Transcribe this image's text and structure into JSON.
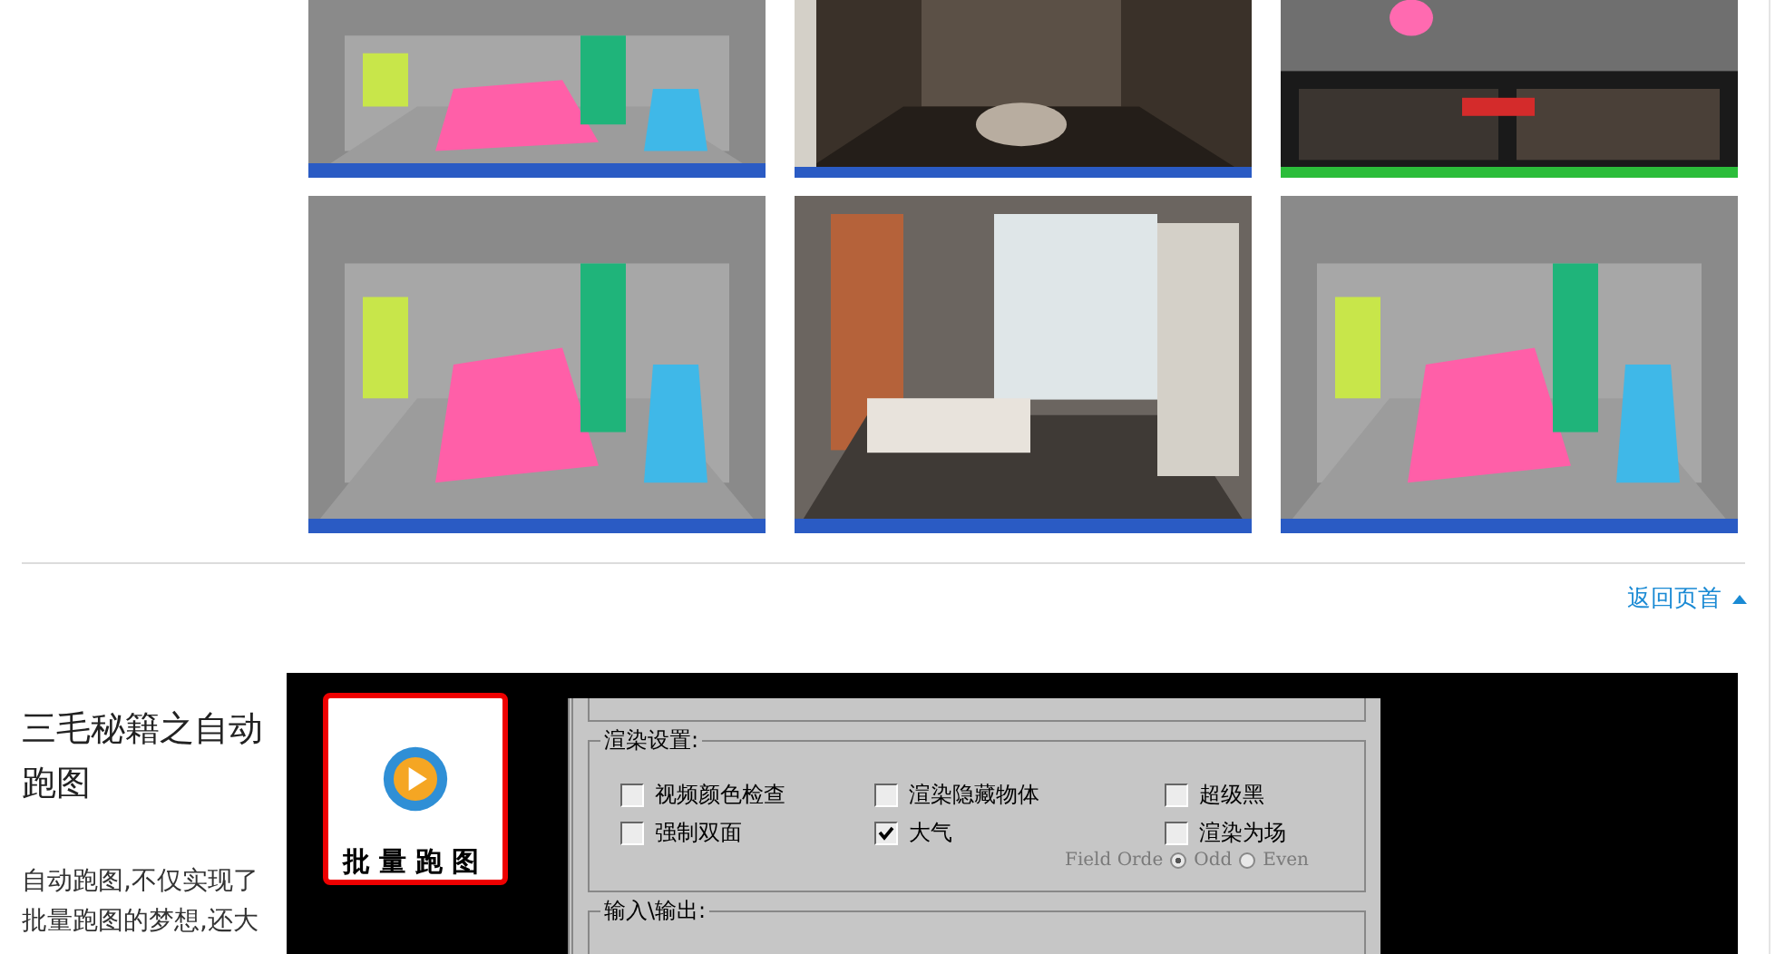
{
  "back_to_top": {
    "label": "返回页首"
  },
  "article": {
    "title": "三毛秘籍之自动跑图",
    "body": "自动跑图,不仅实现了批量跑图的梦想,还大",
    "figure": {
      "logo": {
        "label": "批量跑图"
      },
      "dialog": {
        "groups": [
          {
            "title": "渲染设置:",
            "options": [
              {
                "label": "视频颜色检查",
                "checked": false
              },
              {
                "label": "渲染隐藏物体",
                "checked": false
              },
              {
                "label": "超级黑",
                "checked": false
              },
              {
                "label": "强制双面",
                "checked": false
              },
              {
                "label": "大气",
                "checked": true
              },
              {
                "label": "渲染为场",
                "checked": false
              }
            ],
            "field_order": {
              "label": "Field Orde",
              "disabled": true,
              "options": [
                {
                  "label": "Odd",
                  "selected": true
                },
                {
                  "label": "Even",
                  "selected": false
                }
              ]
            }
          },
          {
            "title": "输入\\输出:"
          }
        ]
      }
    }
  }
}
